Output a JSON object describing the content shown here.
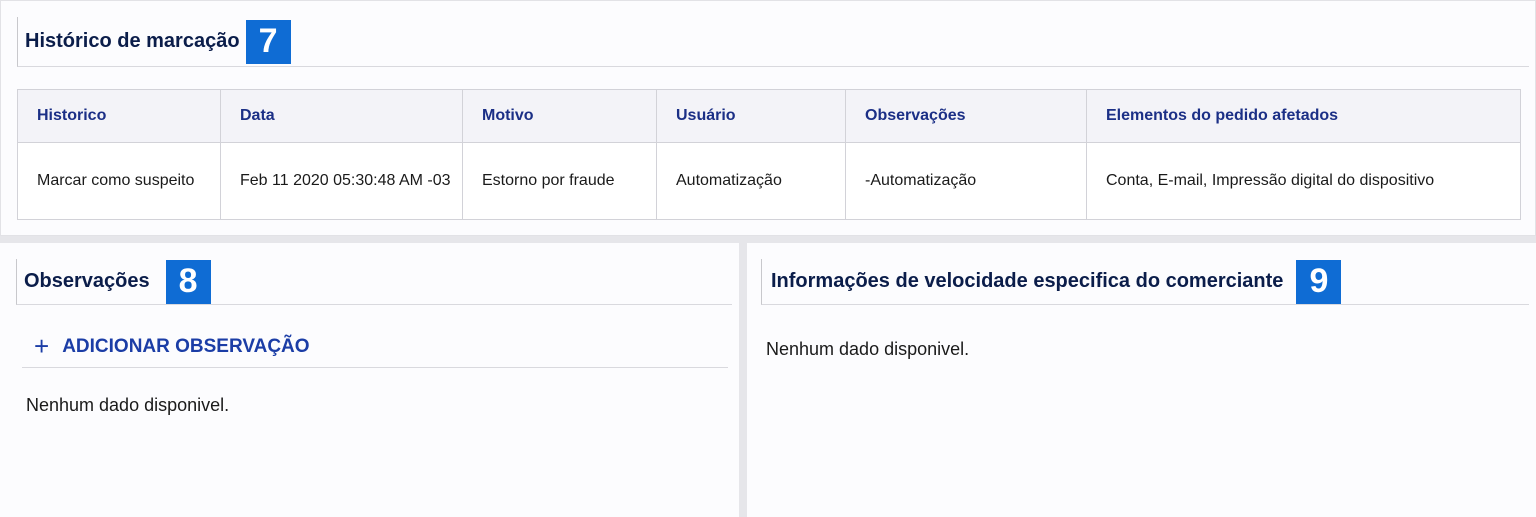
{
  "history_section": {
    "title": "Histórico de marcação",
    "badge": "7",
    "columns": [
      "Historico",
      "Data",
      "Motivo",
      "Usuário",
      "Observações",
      "Elementos do pedido afetados"
    ],
    "rows": [
      {
        "historico": "Marcar como suspeito",
        "data": "Feb 11 2020 05:30:48 AM -03",
        "motivo": "Estorno por fraude",
        "usuario": "Automatização",
        "observacoes": "-Automatização",
        "elementos": "Conta, E-mail, Impressão digital do dispositivo"
      }
    ]
  },
  "observations_section": {
    "title": "Observações",
    "badge": "8",
    "add_label": "ADICIONAR OBSERVAÇÃO",
    "add_icon": "plus-icon",
    "empty_text": "Nenhum dado disponivel."
  },
  "velocity_section": {
    "title": "Informações de velocidade especifica do comerciante",
    "badge": "9",
    "empty_text": "Nenhum dado disponivel."
  },
  "colors": {
    "badge": "#0f6cd4",
    "title": "#0b1d4a",
    "link": "#1b3da6",
    "table_header_text": "#1b2f86"
  }
}
